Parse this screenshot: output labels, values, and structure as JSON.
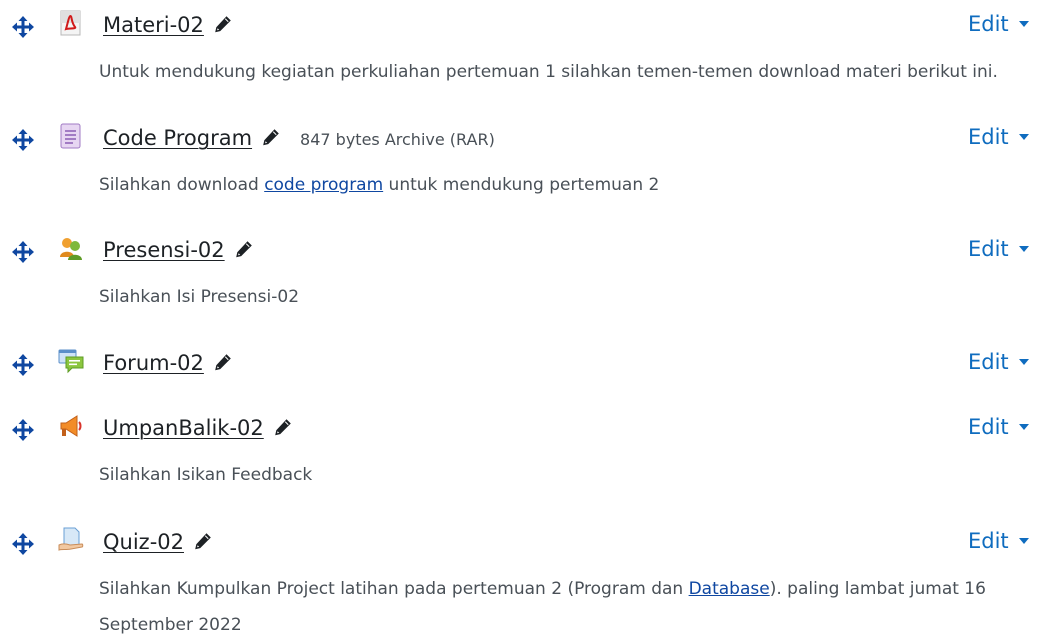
{
  "colors": {
    "accent": "#0f6cbf",
    "text": "#1d2125",
    "muted": "#495057",
    "link": "#0f47a1"
  },
  "edit_label": "Edit",
  "activities": [
    {
      "name": "Materi-02",
      "icon": "pdf-icon",
      "description": "Untuk mendukung kegiatan perkuliahan pertemuan 1 silahkan temen-temen download materi berikut ini."
    },
    {
      "name": "Code Program",
      "icon": "archive-icon",
      "meta": "847 bytes Archive (RAR)",
      "description_before": "Silahkan download ",
      "description_link": "code program",
      "description_after": " untuk mendukung pertemuan 2"
    },
    {
      "name": "Presensi-02",
      "icon": "attendance-icon",
      "description": "Silahkan Isi Presensi-02"
    },
    {
      "name": "Forum-02",
      "icon": "forum-icon"
    },
    {
      "name": "UmpanBalik-02",
      "icon": "feedback-icon",
      "description": "Silahkan Isikan Feedback"
    },
    {
      "name": "Quiz-02",
      "icon": "quiz-icon",
      "description_before": "Silahkan Kumpulkan Project latihan pada pertemuan 2 (Program dan ",
      "description_link": "Database",
      "description_after": "). paling lambat jumat 16 September 2022"
    }
  ]
}
